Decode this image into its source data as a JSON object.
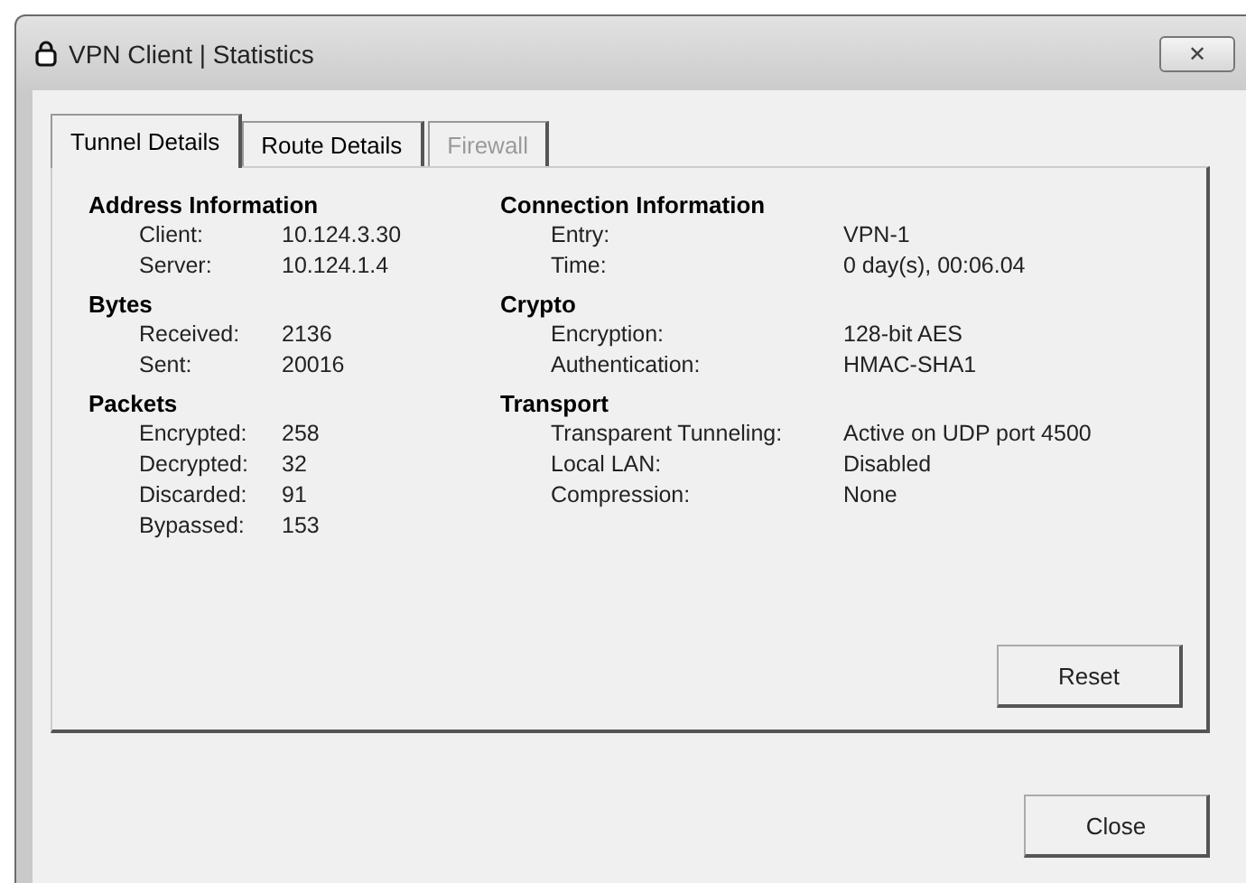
{
  "window": {
    "title": "VPN Client | Statistics",
    "close_button": "✕"
  },
  "tabs": [
    {
      "label": "Tunnel Details",
      "selected": true,
      "disabled": false
    },
    {
      "label": "Route Details",
      "selected": false,
      "disabled": false
    },
    {
      "label": "Firewall",
      "selected": false,
      "disabled": true
    }
  ],
  "columns": [
    {
      "sections": [
        {
          "title": "Address Information",
          "rows": [
            {
              "label": "Client:",
              "value": "10.124.3.30"
            },
            {
              "label": "Server:",
              "value": "10.124.1.4"
            }
          ]
        },
        {
          "title": "Bytes",
          "rows": [
            {
              "label": "Received:",
              "value": "2136"
            },
            {
              "label": "Sent:",
              "value": "20016"
            }
          ]
        },
        {
          "title": "Packets",
          "rows": [
            {
              "label": "Encrypted:",
              "value": "258"
            },
            {
              "label": "Decrypted:",
              "value": "32"
            },
            {
              "label": "Discarded:",
              "value": "91"
            },
            {
              "label": "Bypassed:",
              "value": "153"
            }
          ]
        }
      ]
    },
    {
      "sections": [
        {
          "title": "Connection Information",
          "rows": [
            {
              "label": "Entry:",
              "value": "VPN-1"
            },
            {
              "label": "Time:",
              "value": "0 day(s), 00:06.04"
            }
          ]
        },
        {
          "title": "Crypto",
          "rows": [
            {
              "label": "Encryption:",
              "value": "128-bit AES"
            },
            {
              "label": "Authentication:",
              "value": "HMAC-SHA1"
            }
          ]
        },
        {
          "title": "Transport",
          "rows": [
            {
              "label": "Transparent Tunneling:",
              "value": "Active on UDP port 4500"
            },
            {
              "label": "Local LAN:",
              "value": "Disabled"
            },
            {
              "label": "Compression:",
              "value": "None"
            }
          ]
        }
      ]
    }
  ],
  "reset_button": "Reset",
  "close_button": "Close"
}
